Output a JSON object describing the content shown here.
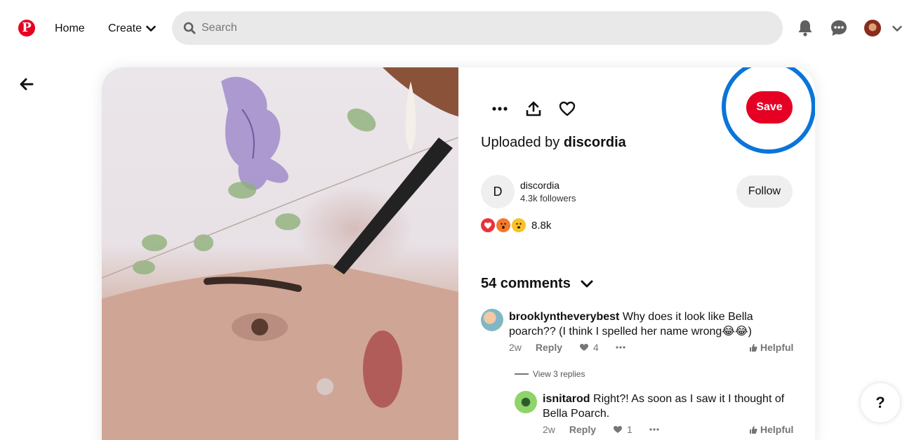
{
  "header": {
    "logo_letter": "P",
    "nav_home": "Home",
    "nav_create": "Create",
    "search_placeholder": "Search"
  },
  "pin": {
    "save_label": "Save",
    "uploaded_prefix": "Uploaded by",
    "uploaded_by": "discordia",
    "creator": {
      "initial": "D",
      "name": "discordia",
      "followers": "4.3k followers",
      "follow_label": "Follow"
    },
    "reaction_count": "8.8k",
    "comments_title": "54 comments"
  },
  "comments": [
    {
      "user": "brooklyntheverybest",
      "text": "Why does it look like Bella poarch?? (I think I spelled her name wrong😂😂)",
      "time": "2w",
      "reply_label": "Reply",
      "likes": "4",
      "helpful_label": "Helpful"
    },
    {
      "user": "isnitarod",
      "text": "Right?! As soon as I saw it I thought of Bella Poarch.",
      "time": "2w",
      "reply_label": "Reply",
      "likes": "1",
      "helpful_label": "Helpful"
    }
  ],
  "view_replies": "View 3 replies",
  "help_label": "?",
  "colors": {
    "brand": "#e60023",
    "highlight_ring": "#0a74da"
  }
}
